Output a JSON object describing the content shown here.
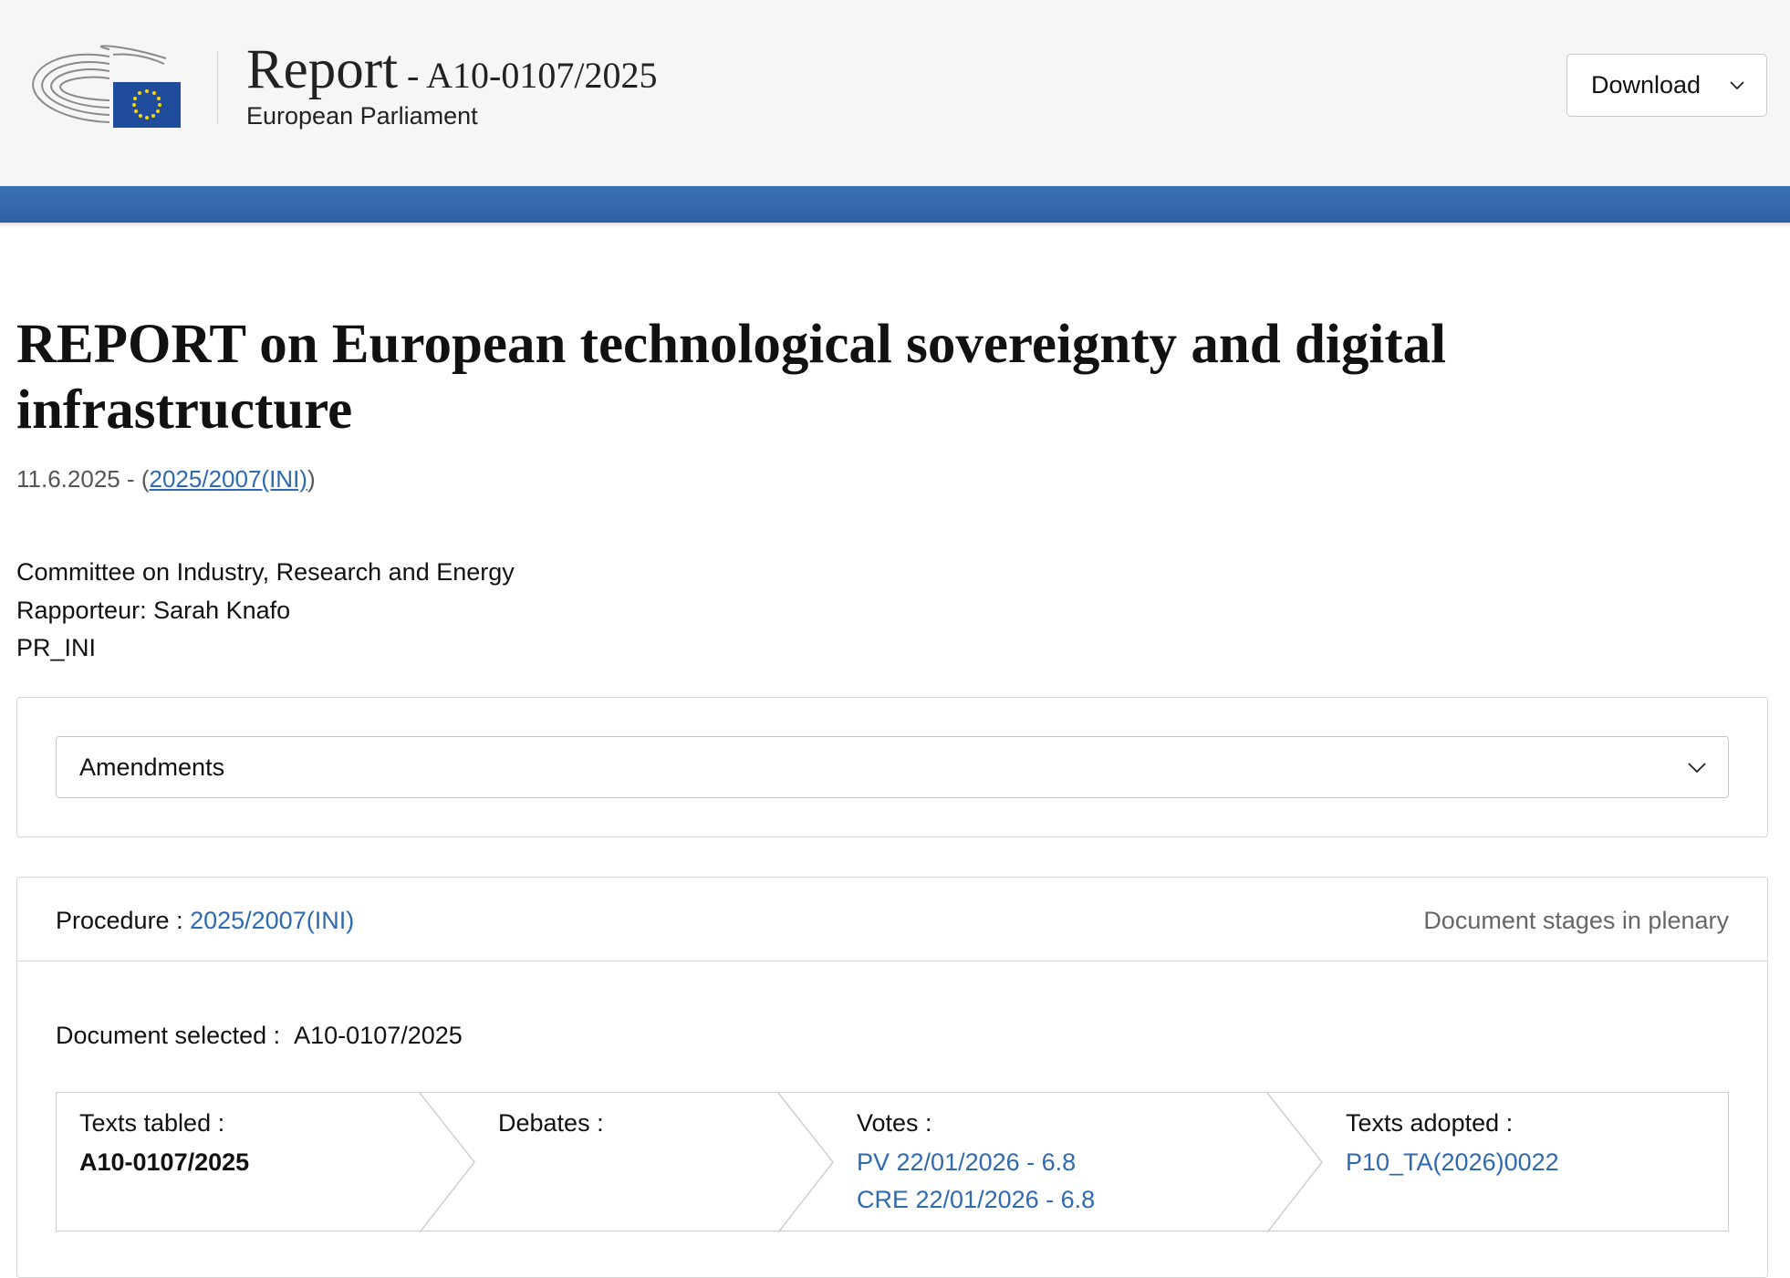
{
  "header": {
    "title_main": "Report",
    "title_ref": " - A10-0107/2025",
    "subtitle": "European Parliament",
    "download_label": "Download"
  },
  "document": {
    "title": "REPORT on European technological sovereignty and digital infrastructure",
    "date": "11.6.2025",
    "date_separator": " - (",
    "procedure_link": "2025/2007(INI)",
    "procedure_close": ")",
    "committee": "Committee on Industry, Research and Energy",
    "rapporteur": "Rapporteur: Sarah Knafo",
    "type_code": "PR_INI"
  },
  "amendments": {
    "label": "Amendments"
  },
  "procedure": {
    "label": "Procedure : ",
    "link": "2025/2007(INI)",
    "stages_label": "Document stages in plenary",
    "document_selected_label": "Document selected :",
    "document_selected_value": "A10-0107/2025",
    "stages": {
      "texts_tabled": {
        "label": "Texts tabled :",
        "value": "A10-0107/2025"
      },
      "debates": {
        "label": "Debates :"
      },
      "votes": {
        "label": "Votes :",
        "links": [
          "PV 22/01/2026 - 6.8",
          "CRE 22/01/2026 - 6.8"
        ]
      },
      "texts_adopted": {
        "label": "Texts adopted :",
        "link": "P10_TA(2026)0022"
      }
    }
  },
  "colors": {
    "header_bg": "#f6f6f7",
    "blue_band": "#3a71b5",
    "link": "#2e6ab1",
    "eu_flag": "#1f4d9c",
    "eu_star": "#ffd500"
  },
  "icons": {
    "logo": "european-parliament-logo",
    "download_chevron": "chevron-down-icon",
    "amendments_chevron": "chevron-down-icon"
  }
}
